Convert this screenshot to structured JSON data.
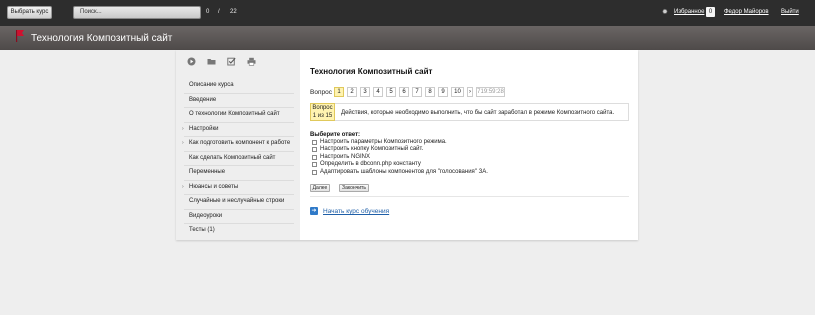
{
  "topbar": {
    "choose_course": "Выбрать курс",
    "search_placeholder": "Поиск...",
    "count_current": "0",
    "count_sep": "/",
    "count_total": "22",
    "favorites_label": "Избранное",
    "favorites_count": "0",
    "user_name": "Федор Майоров",
    "exit_label": "Выйти"
  },
  "header": {
    "title": "Технология Композитный сайт"
  },
  "sidebar": {
    "items": [
      {
        "label": "Описание курса",
        "arrow": ""
      },
      {
        "label": "Введение",
        "arrow": ""
      },
      {
        "label": "О технологии Композитный сайт",
        "arrow": ""
      },
      {
        "label": "Настройки",
        "arrow": "›"
      },
      {
        "label": "Как подготовить компонент к работе",
        "arrow": "›"
      },
      {
        "label": "Как сделать Композитный сайт",
        "arrow": ""
      },
      {
        "label": "Переменные",
        "arrow": ""
      },
      {
        "label": "Нюансы и советы",
        "arrow": "›"
      },
      {
        "label": "Случайные и неслучайные строки",
        "arrow": ""
      },
      {
        "label": "Видеоуроки",
        "arrow": ""
      },
      {
        "label": "Тесты (1)",
        "arrow": ""
      }
    ]
  },
  "main": {
    "title": "Технология Композитный сайт",
    "question_label": "Вопрос",
    "question_numbers": [
      "1",
      "2",
      "3",
      "4",
      "5",
      "6",
      "7",
      "8",
      "9",
      "10",
      "›"
    ],
    "timer": "719:59:28",
    "badge_line1": "Вопрос",
    "badge_line2": "1 из 15",
    "question_text": "Действия, которые необходимо выполнить, что бы сайт заработал в режиме Композитного сайта.",
    "choose_answer": "Выберите ответ:",
    "options": [
      "Настроить параметры Композитного режима.",
      "Настроить кнопку Композитный сайт.",
      "Настроить NGINX",
      "Определить в dbconn.php константу",
      "Адаптировать шаблоны компонентов для \"голосования\" ЗА."
    ],
    "next_label": "Далее",
    "finish_label": "Закончить",
    "start_link": "Начать курс обучения"
  },
  "colors": {
    "accent": "#2f7ac8",
    "highlight": "#fff3b0",
    "topbar": "#2d2d2d",
    "logo": "#c8102e"
  }
}
